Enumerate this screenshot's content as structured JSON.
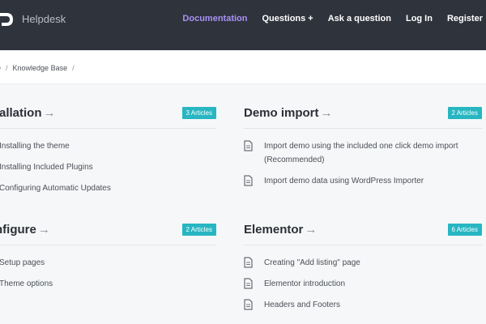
{
  "header": {
    "logo_text": "Helpdesk",
    "nav": [
      {
        "label": "Documentation",
        "active": true
      },
      {
        "label": "Questions",
        "suffix": "+"
      },
      {
        "label": "Ask a question"
      },
      {
        "label": "Log In"
      },
      {
        "label": "Register"
      }
    ]
  },
  "breadcrumb": {
    "items": [
      "e",
      "Knowledge Base"
    ]
  },
  "sections": {
    "installation": {
      "title": "tallation",
      "badge": "3 Articles",
      "articles": [
        "Installing the theme",
        "Installing Included Plugins",
        "Configuring Automatic Updates"
      ]
    },
    "demo_import": {
      "title": "Demo import",
      "badge": "2 Articles",
      "articles": [
        "Import demo using the included one click demo import (Recommended)",
        "Import demo data using WordPress Importer"
      ]
    },
    "configure": {
      "title": "nfigure",
      "badge": "2 Articles",
      "articles": [
        "Setup pages",
        "Theme options"
      ]
    },
    "elementor": {
      "title": "Elementor",
      "badge": "6 Articles",
      "articles": [
        "Creating \"Add listing\" page",
        "Elementor introduction",
        "Headers and Footers"
      ]
    }
  },
  "arrow_glyph": "→",
  "colors": {
    "header_bg": "#2f333c",
    "accent_nav": "#a892f5",
    "badge_bg": "#27b6c2"
  }
}
